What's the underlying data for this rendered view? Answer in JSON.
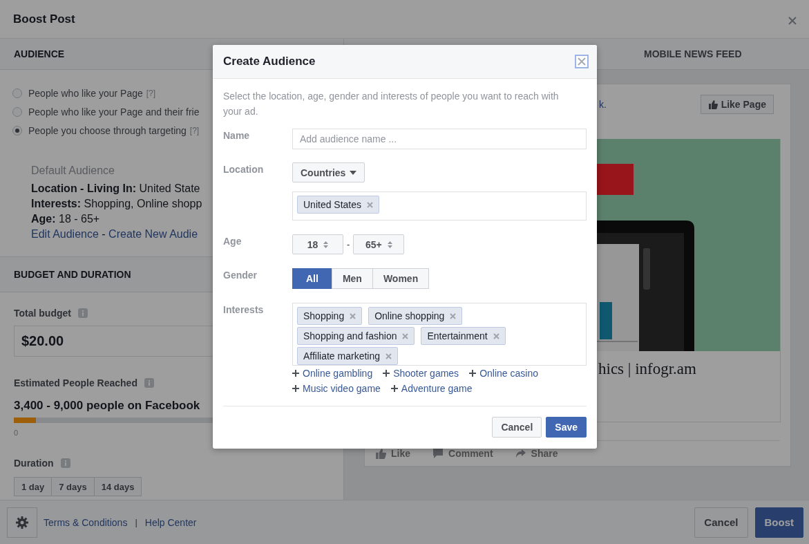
{
  "window": {
    "title": "Boost Post"
  },
  "audience": {
    "heading": "AUDIENCE",
    "options": [
      {
        "label": "People who like your Page",
        "help": "[?]",
        "selected": false
      },
      {
        "label": "People who like your Page and their frie",
        "selected": false
      },
      {
        "label": "People you choose through targeting",
        "help": "[?]",
        "selected": true
      }
    ],
    "summary": {
      "title": "Default Audience",
      "lines": [
        "**Location - Living In:** United State",
        "**Interests:** Shopping, Online shopp",
        "**Age:** 18 - 65+"
      ],
      "links": [
        "Edit Audience",
        "Create New Audie"
      ],
      "separator": "-"
    }
  },
  "budget": {
    "heading": "BUDGET AND DURATION",
    "total_label": "Total budget",
    "total_value": "$20.00",
    "reach": {
      "label": "Estimated People Reached",
      "text": "3,400 - 9,000 people on Facebook",
      "level": 0.07,
      "min": "0"
    },
    "duration_label": "Duration",
    "durations": [
      "1 day",
      "7 days",
      "14 days"
    ]
  },
  "preview": {
    "tab": "MOBILE NEWS FEED",
    "page_link": "k.",
    "like_page": "Like Page",
    "link_title": "hics | infogr.am",
    "actions": [
      "Like",
      "Comment",
      "Share"
    ]
  },
  "footer": {
    "links": [
      "Terms & Conditions",
      "Help Center"
    ],
    "separator": "|",
    "buttons": [
      {
        "label": "Cancel",
        "kind": "secondary"
      },
      {
        "label": "Boost",
        "kind": "primary"
      }
    ]
  },
  "modal": {
    "title": "Create Audience",
    "description": "Select the location, age, gender and interests of people you want to reach with your ad.",
    "name_label": "Name",
    "name_placeholder": "Add audience name ...",
    "location_label": "Location",
    "location_type": "Countries",
    "locations": [
      "United States"
    ],
    "age_label": "Age",
    "age_min": "18",
    "age_separator": "-",
    "age_max": "65+",
    "gender_label": "Gender",
    "genders": [
      {
        "label": "All",
        "selected": true
      },
      {
        "label": "Men",
        "selected": false
      },
      {
        "label": "Women",
        "selected": false
      }
    ],
    "interests_label": "Interests",
    "interests": [
      "Shopping",
      "Online shopping",
      "Shopping and fashion",
      "Entertainment",
      "Affiliate marketing"
    ],
    "suggestions": [
      "Online gambling",
      "Shooter games",
      "Online casino",
      "Music video game",
      "Adventure game"
    ],
    "buttons": [
      {
        "label": "Cancel",
        "kind": "secondary"
      },
      {
        "label": "Save",
        "kind": "primary"
      }
    ]
  }
}
